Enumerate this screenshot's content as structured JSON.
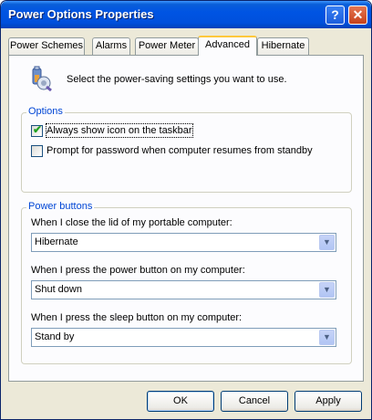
{
  "window": {
    "title": "Power Options Properties"
  },
  "titlebar": {
    "help_glyph": "?",
    "close_glyph": "✕"
  },
  "tabs": [
    {
      "label": "Power Schemes"
    },
    {
      "label": "Alarms"
    },
    {
      "label": "Power Meter"
    },
    {
      "label": "Advanced",
      "active": true
    },
    {
      "label": "Hibernate"
    }
  ],
  "intro": {
    "text": "Select the power-saving settings you want to use.",
    "icon": "power-settings-icon"
  },
  "options": {
    "title": "Options",
    "show_icon": {
      "label": "Always show icon on the taskbar",
      "checked": true
    },
    "prompt_password": {
      "label": "Prompt for password when computer resumes from standby",
      "checked": false
    }
  },
  "power_buttons": {
    "title": "Power buttons",
    "lid": {
      "label": "When I close the lid of my portable computer:",
      "value": "Hibernate"
    },
    "power": {
      "label": "When I press the power button on my computer:",
      "value": "Shut down"
    },
    "sleep": {
      "label": "When I press the sleep button on my computer:",
      "value": "Stand by"
    }
  },
  "buttons": {
    "ok": "OK",
    "cancel": "Cancel",
    "apply": "Apply"
  },
  "colors": {
    "titlebar": "#0054e3",
    "tab_highlight": "#ffc83c",
    "group_label": "#0046d5",
    "dialog_bg": "#ece9d8"
  }
}
